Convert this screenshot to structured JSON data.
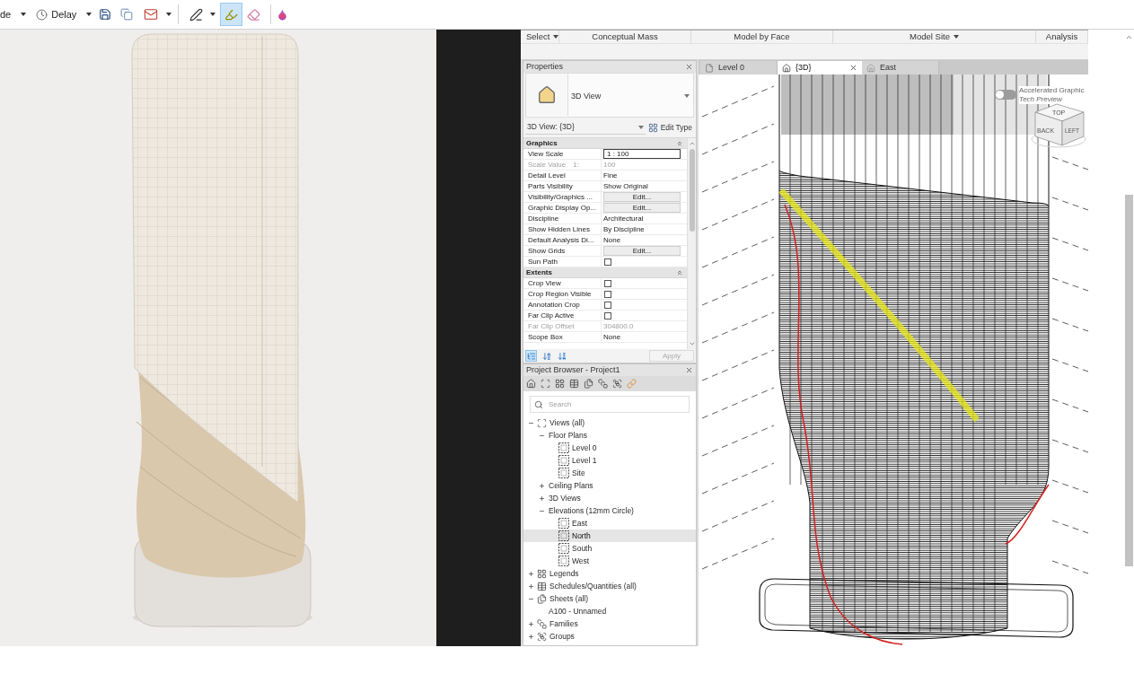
{
  "toolbar": {
    "mode": {
      "label": "de"
    },
    "delay": {
      "label": "Delay"
    },
    "tools": [
      {
        "kind": "pen",
        "selected": false,
        "dropdown": true
      },
      {
        "kind": "highlighter",
        "selected": true,
        "dropdown": false
      },
      {
        "kind": "eraser",
        "selected": false,
        "dropdown": false
      }
    ]
  },
  "ribbon": {
    "panels": [
      {
        "label": "Select",
        "dropdown": true
      },
      {
        "label": "Conceptual Mass",
        "dropdown": false
      },
      {
        "label": "Model by Face",
        "dropdown": false
      },
      {
        "label": "Model Site",
        "dropdown": true
      },
      {
        "label": "Analysis",
        "dropdown": false
      }
    ]
  },
  "properties": {
    "title": "Properties",
    "type_selector": {
      "name": "3D View"
    },
    "instance_selector": {
      "label": "3D View: {3D}"
    },
    "edit_type": {
      "label": "Edit Type"
    },
    "sections": [
      {
        "title": "Graphics",
        "expanded": true,
        "rows": [
          {
            "name": "View Scale",
            "kind": "input",
            "value": "1 : 100",
            "disabled": false
          },
          {
            "name": "Scale Value",
            "prefix": "1:",
            "kind": "text",
            "value": "100",
            "disabled": true
          },
          {
            "name": "Detail Level",
            "kind": "text",
            "value": "Fine",
            "disabled": false
          },
          {
            "name": "Parts Visibility",
            "kind": "text",
            "value": "Show Original",
            "disabled": false
          },
          {
            "name": "Visibility/Graphics ...",
            "kind": "button",
            "value": "Edit...",
            "disabled": false
          },
          {
            "name": "Graphic Display Op...",
            "kind": "button",
            "value": "Edit...",
            "disabled": false
          },
          {
            "name": "Discipline",
            "kind": "text",
            "value": "Architectural",
            "disabled": false
          },
          {
            "name": "Show Hidden Lines",
            "kind": "text",
            "value": "By Discipline",
            "disabled": false
          },
          {
            "name": "Default Analysis Di...",
            "kind": "text",
            "value": "None",
            "disabled": false
          },
          {
            "name": "Show Grids",
            "kind": "button",
            "value": "Edit...",
            "disabled": false
          },
          {
            "name": "Sun Path",
            "kind": "checkbox",
            "checked": false,
            "disabled": false
          }
        ]
      },
      {
        "title": "Extents",
        "expanded": true,
        "rows": [
          {
            "name": "Crop View",
            "kind": "checkbox",
            "checked": false,
            "disabled": false
          },
          {
            "name": "Crop Region Visible",
            "kind": "checkbox",
            "checked": false,
            "disabled": false
          },
          {
            "name": "Annotation Crop",
            "kind": "checkbox",
            "checked": false,
            "disabled": false
          },
          {
            "name": "Far Clip Active",
            "kind": "checkbox",
            "checked": false,
            "disabled": false
          },
          {
            "name": "Far Clip Offset",
            "kind": "text",
            "value": "304800.0",
            "disabled": true
          },
          {
            "name": "Scope Box",
            "kind": "text",
            "value": "None",
            "disabled": false
          }
        ]
      }
    ],
    "view_buttons": [
      {
        "kind": "categorize",
        "selected": true
      },
      {
        "kind": "sort-ascending",
        "selected": false
      },
      {
        "kind": "sort-descending",
        "selected": false
      }
    ],
    "apply": {
      "label": "Apply",
      "disabled": true
    }
  },
  "project_browser": {
    "title": "Project Browser - Project1",
    "tools": [
      {
        "kind": "home"
      },
      {
        "kind": "views"
      },
      {
        "kind": "legends"
      },
      {
        "kind": "schedules"
      },
      {
        "kind": "sheets"
      },
      {
        "kind": "families"
      },
      {
        "kind": "groups"
      },
      {
        "kind": "links"
      }
    ],
    "search": {
      "placeholder": "Search"
    },
    "tree": [
      {
        "label": "Views (all)",
        "kind": "views",
        "expanded": true,
        "selected": false,
        "children": [
          {
            "label": "Floor Plans",
            "kind": "plain",
            "expanded": true,
            "selected": false,
            "children": [
              {
                "label": "Level 0",
                "kind": "view",
                "selected": false
              },
              {
                "label": "Level 1",
                "kind": "view",
                "selected": false
              },
              {
                "label": "Site",
                "kind": "view",
                "selected": false
              }
            ]
          },
          {
            "label": "Ceiling Plans",
            "kind": "plain",
            "expanded": false,
            "selected": false
          },
          {
            "label": "3D Views",
            "kind": "plain",
            "expanded": false,
            "selected": false
          },
          {
            "label": "Elevations (12mm Circle)",
            "kind": "plain",
            "expanded": true,
            "selected": false,
            "children": [
              {
                "label": "East",
                "kind": "view",
                "selected": false
              },
              {
                "label": "North",
                "kind": "view",
                "selected": true
              },
              {
                "label": "South",
                "kind": "view",
                "selected": false
              },
              {
                "label": "West",
                "kind": "view",
                "selected": false
              }
            ]
          }
        ]
      },
      {
        "label": "Legends",
        "kind": "legends",
        "expanded": false,
        "selected": false
      },
      {
        "label": "Schedules/Quantities (all)",
        "kind": "schedules",
        "expanded": false,
        "selected": false
      },
      {
        "label": "Sheets (all)",
        "kind": "sheets",
        "expanded": true,
        "selected": false,
        "children": [
          {
            "label": "A100 - Unnamed",
            "kind": "plain",
            "selected": false
          }
        ]
      },
      {
        "label": "Families",
        "kind": "families",
        "expanded": false,
        "selected": false
      },
      {
        "label": "Groups",
        "kind": "groups",
        "expanded": false,
        "selected": false
      }
    ]
  },
  "view_tabs": [
    {
      "label": "Level 0",
      "kind": "plan",
      "selected": false
    },
    {
      "label": "{3D}",
      "kind": "perspective",
      "selected": true
    },
    {
      "label": "East",
      "kind": "elevation",
      "selected": false
    }
  ],
  "viewport": {
    "graphics_toggle": {
      "label": "Accelerated Graphic",
      "note": "Tech Preview",
      "on": false
    },
    "view_cube": {
      "top": "TOP",
      "front": "BACK",
      "side": "LEFT"
    }
  }
}
